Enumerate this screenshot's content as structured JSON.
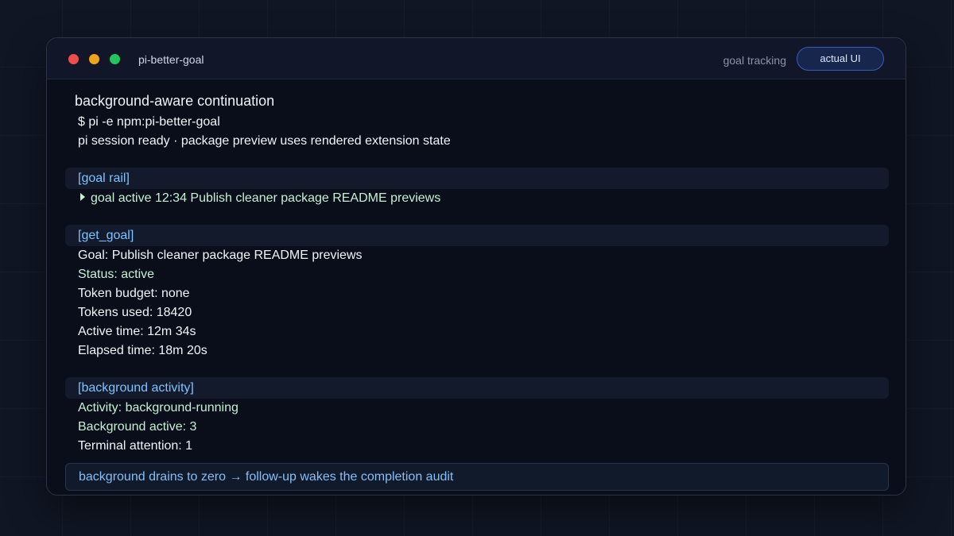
{
  "window": {
    "title": "pi-better-goal",
    "subtitle": "goal tracking",
    "badge": "actual UI"
  },
  "colors": {
    "close": "#ee4d4d",
    "minimize": "#f0a41c",
    "maximize": "#22c55e",
    "accent_blue": "#7ec3ff",
    "accent_green": "#c6f0d4"
  },
  "main": {
    "heading": "background-aware continuation",
    "command": "$ pi -e npm:pi-better-goal",
    "session_line": "pi session ready · package preview uses rendered extension state"
  },
  "goal_rail": {
    "label": "[goal rail]",
    "icon": "caret-right-icon",
    "text": "goal active 12:34 Publish cleaner package README previews"
  },
  "get_goal": {
    "label": "[get_goal]",
    "goal": "Goal: Publish cleaner package README previews",
    "status": "Status: active",
    "token_budget": "Token budget: none",
    "tokens_used": "Tokens used: 18420",
    "active_time": "Active time: 12m 34s",
    "elapsed_time": "Elapsed time: 18m 20s"
  },
  "background_activity": {
    "label": "[background activity]",
    "activity": "Activity: background-running",
    "background_active": "Background active: 3",
    "terminal_attention": "Terminal attention: 1"
  },
  "footer": {
    "text": "background drains to zero → follow-up wakes the completion audit"
  }
}
